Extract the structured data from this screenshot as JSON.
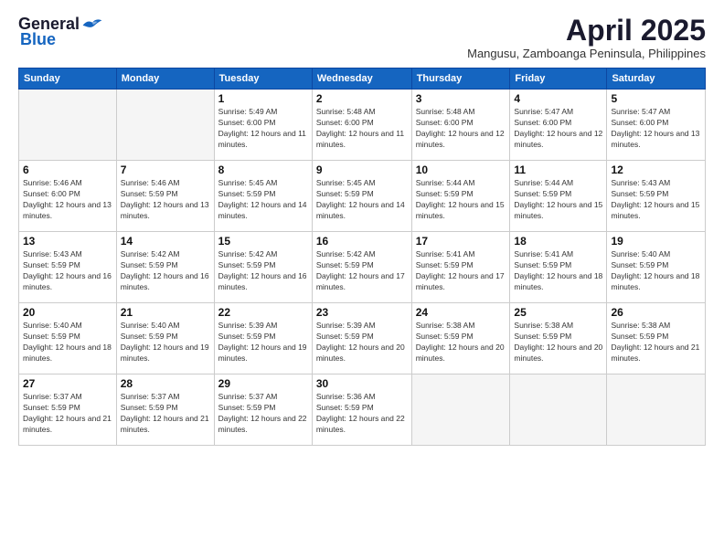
{
  "header": {
    "logo_general": "General",
    "logo_blue": "Blue",
    "title": "April 2025",
    "subtitle": "Mangusu, Zamboanga Peninsula, Philippines"
  },
  "calendar": {
    "weekdays": [
      "Sunday",
      "Monday",
      "Tuesday",
      "Wednesday",
      "Thursday",
      "Friday",
      "Saturday"
    ],
    "weeks": [
      [
        {
          "day": "",
          "info": ""
        },
        {
          "day": "",
          "info": ""
        },
        {
          "day": "1",
          "info": "Sunrise: 5:49 AM\nSunset: 6:00 PM\nDaylight: 12 hours and 11 minutes."
        },
        {
          "day": "2",
          "info": "Sunrise: 5:48 AM\nSunset: 6:00 PM\nDaylight: 12 hours and 11 minutes."
        },
        {
          "day": "3",
          "info": "Sunrise: 5:48 AM\nSunset: 6:00 PM\nDaylight: 12 hours and 12 minutes."
        },
        {
          "day": "4",
          "info": "Sunrise: 5:47 AM\nSunset: 6:00 PM\nDaylight: 12 hours and 12 minutes."
        },
        {
          "day": "5",
          "info": "Sunrise: 5:47 AM\nSunset: 6:00 PM\nDaylight: 12 hours and 13 minutes."
        }
      ],
      [
        {
          "day": "6",
          "info": "Sunrise: 5:46 AM\nSunset: 6:00 PM\nDaylight: 12 hours and 13 minutes."
        },
        {
          "day": "7",
          "info": "Sunrise: 5:46 AM\nSunset: 5:59 PM\nDaylight: 12 hours and 13 minutes."
        },
        {
          "day": "8",
          "info": "Sunrise: 5:45 AM\nSunset: 5:59 PM\nDaylight: 12 hours and 14 minutes."
        },
        {
          "day": "9",
          "info": "Sunrise: 5:45 AM\nSunset: 5:59 PM\nDaylight: 12 hours and 14 minutes."
        },
        {
          "day": "10",
          "info": "Sunrise: 5:44 AM\nSunset: 5:59 PM\nDaylight: 12 hours and 15 minutes."
        },
        {
          "day": "11",
          "info": "Sunrise: 5:44 AM\nSunset: 5:59 PM\nDaylight: 12 hours and 15 minutes."
        },
        {
          "day": "12",
          "info": "Sunrise: 5:43 AM\nSunset: 5:59 PM\nDaylight: 12 hours and 15 minutes."
        }
      ],
      [
        {
          "day": "13",
          "info": "Sunrise: 5:43 AM\nSunset: 5:59 PM\nDaylight: 12 hours and 16 minutes."
        },
        {
          "day": "14",
          "info": "Sunrise: 5:42 AM\nSunset: 5:59 PM\nDaylight: 12 hours and 16 minutes."
        },
        {
          "day": "15",
          "info": "Sunrise: 5:42 AM\nSunset: 5:59 PM\nDaylight: 12 hours and 16 minutes."
        },
        {
          "day": "16",
          "info": "Sunrise: 5:42 AM\nSunset: 5:59 PM\nDaylight: 12 hours and 17 minutes."
        },
        {
          "day": "17",
          "info": "Sunrise: 5:41 AM\nSunset: 5:59 PM\nDaylight: 12 hours and 17 minutes."
        },
        {
          "day": "18",
          "info": "Sunrise: 5:41 AM\nSunset: 5:59 PM\nDaylight: 12 hours and 18 minutes."
        },
        {
          "day": "19",
          "info": "Sunrise: 5:40 AM\nSunset: 5:59 PM\nDaylight: 12 hours and 18 minutes."
        }
      ],
      [
        {
          "day": "20",
          "info": "Sunrise: 5:40 AM\nSunset: 5:59 PM\nDaylight: 12 hours and 18 minutes."
        },
        {
          "day": "21",
          "info": "Sunrise: 5:40 AM\nSunset: 5:59 PM\nDaylight: 12 hours and 19 minutes."
        },
        {
          "day": "22",
          "info": "Sunrise: 5:39 AM\nSunset: 5:59 PM\nDaylight: 12 hours and 19 minutes."
        },
        {
          "day": "23",
          "info": "Sunrise: 5:39 AM\nSunset: 5:59 PM\nDaylight: 12 hours and 20 minutes."
        },
        {
          "day": "24",
          "info": "Sunrise: 5:38 AM\nSunset: 5:59 PM\nDaylight: 12 hours and 20 minutes."
        },
        {
          "day": "25",
          "info": "Sunrise: 5:38 AM\nSunset: 5:59 PM\nDaylight: 12 hours and 20 minutes."
        },
        {
          "day": "26",
          "info": "Sunrise: 5:38 AM\nSunset: 5:59 PM\nDaylight: 12 hours and 21 minutes."
        }
      ],
      [
        {
          "day": "27",
          "info": "Sunrise: 5:37 AM\nSunset: 5:59 PM\nDaylight: 12 hours and 21 minutes."
        },
        {
          "day": "28",
          "info": "Sunrise: 5:37 AM\nSunset: 5:59 PM\nDaylight: 12 hours and 21 minutes."
        },
        {
          "day": "29",
          "info": "Sunrise: 5:37 AM\nSunset: 5:59 PM\nDaylight: 12 hours and 22 minutes."
        },
        {
          "day": "30",
          "info": "Sunrise: 5:36 AM\nSunset: 5:59 PM\nDaylight: 12 hours and 22 minutes."
        },
        {
          "day": "",
          "info": ""
        },
        {
          "day": "",
          "info": ""
        },
        {
          "day": "",
          "info": ""
        }
      ]
    ]
  }
}
